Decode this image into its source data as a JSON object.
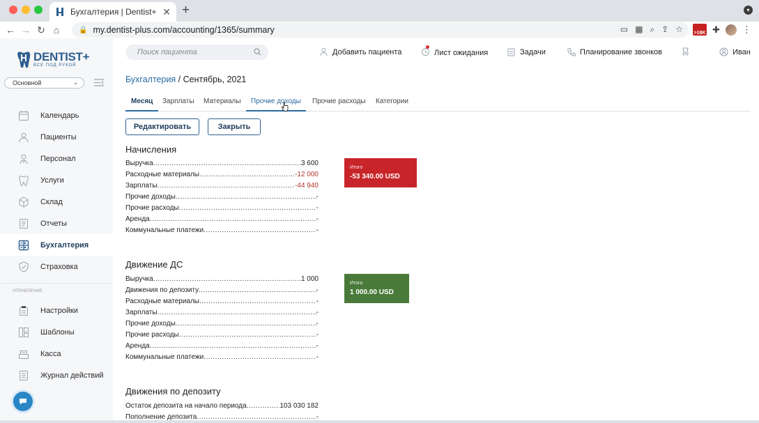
{
  "browser": {
    "tab_title": "Бухгалтерия | Dentist+",
    "new_tab": "+",
    "url": "my.dentist-plus.com/accounting/1365/summary",
    "ext_badge": ">18K"
  },
  "sidebar": {
    "logo_text": "DENTIST+",
    "logo_sub": "ВСЕ ПОД РУКОЙ",
    "branch": "Основной",
    "items": [
      {
        "label": "Календарь",
        "icon": "calendar-icon"
      },
      {
        "label": "Пациенты",
        "icon": "patients-icon"
      },
      {
        "label": "Персонал",
        "icon": "staff-icon"
      },
      {
        "label": "Услуги",
        "icon": "services-icon"
      },
      {
        "label": "Склад",
        "icon": "warehouse-icon"
      },
      {
        "label": "Отчеты",
        "icon": "reports-icon"
      },
      {
        "label": "Бухгалтерия",
        "icon": "accounting-icon",
        "active": true
      },
      {
        "label": "Страховка",
        "icon": "insurance-icon"
      }
    ],
    "section_label": "УПРАВЛЕНИЕ",
    "manage_items": [
      {
        "label": "Настройки",
        "icon": "settings-icon"
      },
      {
        "label": "Шаблоны",
        "icon": "templates-icon"
      },
      {
        "label": "Касса",
        "icon": "cashbox-icon"
      },
      {
        "label": "Журнал действий",
        "icon": "log-icon"
      }
    ]
  },
  "topbar": {
    "search_placeholder": "Поиск пациента",
    "add_patient": "Добавить пациента",
    "waitlist": "Лист ожидания",
    "tasks": "Задачи",
    "call_planning": "Планирование звонков",
    "user": "Иван"
  },
  "breadcrumb": {
    "link": "Бухгалтерия",
    "current": " / Сентябрь, 2021"
  },
  "tabs": [
    "Месяц",
    "Зарплаты",
    "Материалы",
    "Прочие доходы",
    "Прочие расходы",
    "Категории"
  ],
  "buttons": {
    "edit": "Редактировать",
    "close": "Закрыть"
  },
  "accruals": {
    "title": "Начисления",
    "rows": [
      {
        "label": "Выручка",
        "value": "3 600",
        "neg": false
      },
      {
        "label": "Расходные материалы",
        "value": "-12 000",
        "neg": true
      },
      {
        "label": "Зарплаты",
        "value": "-44 940",
        "neg": true
      },
      {
        "label": "Прочие доходы",
        "value": "-",
        "neg": false
      },
      {
        "label": "Прочие расходы",
        "value": "-",
        "neg": false
      },
      {
        "label": "Аренда",
        "value": "-",
        "neg": false
      },
      {
        "label": "Коммунальные платежи",
        "value": "-",
        "neg": false
      }
    ],
    "total_label": "Итого",
    "total_value": "-53 340.00 USD"
  },
  "cashflow": {
    "title": "Движение ДС",
    "rows": [
      {
        "label": "Выручка",
        "value": "1 000",
        "neg": false
      },
      {
        "label": "Движения по депозиту",
        "value": "-",
        "neg": false
      },
      {
        "label": "Расходные материалы",
        "value": "-",
        "neg": false
      },
      {
        "label": "Зарплаты",
        "value": "-",
        "neg": false
      },
      {
        "label": "Прочие доходы",
        "value": "-",
        "neg": false
      },
      {
        "label": "Прочие расходы",
        "value": "-",
        "neg": false
      },
      {
        "label": "Аренда",
        "value": "-",
        "neg": false
      },
      {
        "label": "Коммунальные платежи",
        "value": "-",
        "neg": false
      }
    ],
    "total_label": "Итого",
    "total_value": "1 000.00 USD"
  },
  "deposit": {
    "title": "Движения по депозиту",
    "rows": [
      {
        "label": "Остаток депозита на начало периода",
        "value": "103 030 182",
        "neg": false
      },
      {
        "label": "Пополнение депозита",
        "value": "-",
        "neg": false
      }
    ]
  },
  "colors": {
    "accent": "#2a6aa0",
    "negative_total": "#c8252a",
    "positive_total": "#4a7a3a"
  }
}
